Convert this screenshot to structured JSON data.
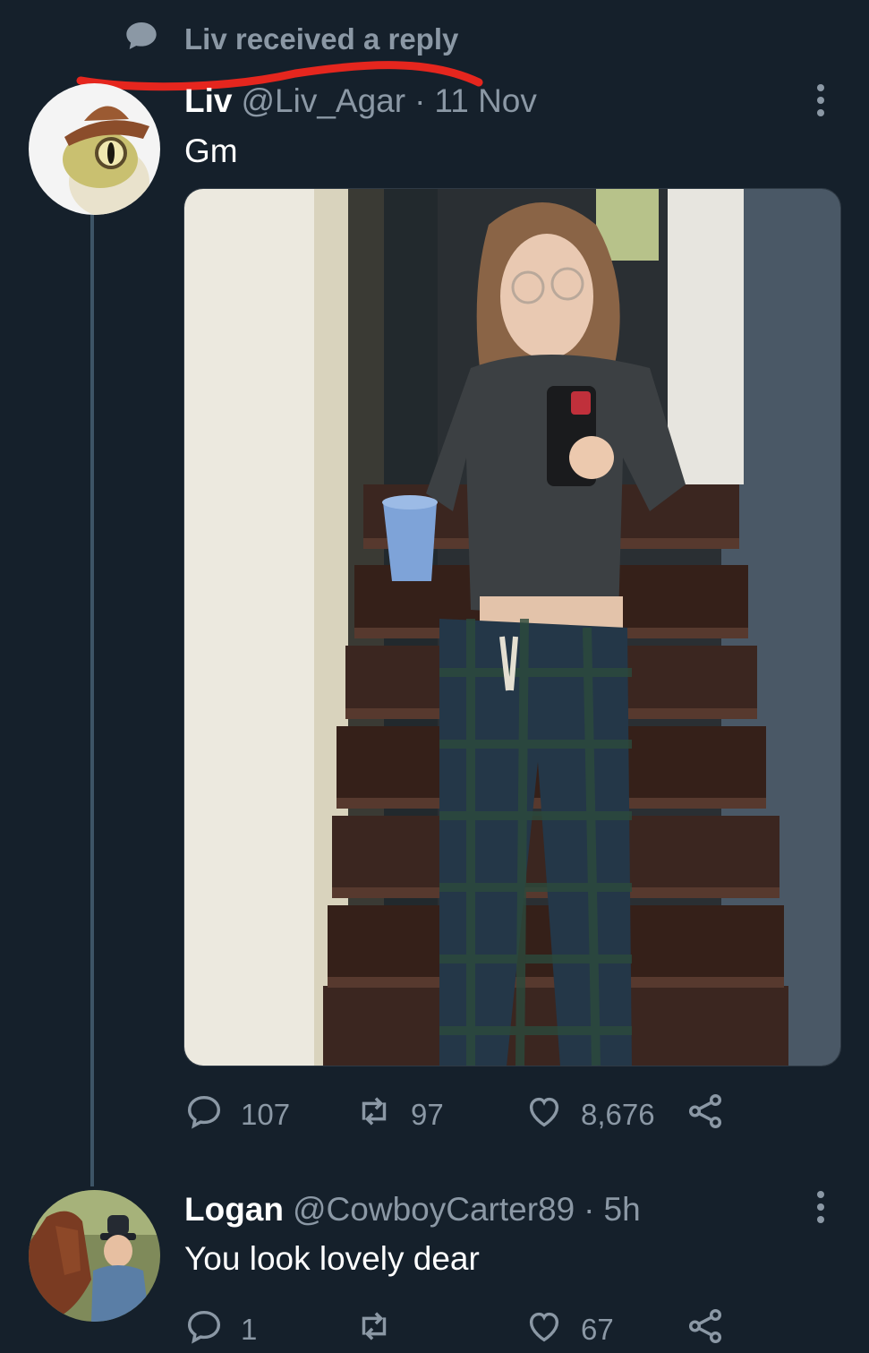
{
  "context": {
    "text": "Liv received a reply",
    "icon": "speech-bubble-icon"
  },
  "tweet": {
    "name": "Liv",
    "handle": "@Liv_Agar",
    "separator": "·",
    "time": "11 Nov",
    "text": "Gm",
    "media": "photo",
    "actions": {
      "replies": "107",
      "retweets": "97",
      "likes": "8,676"
    }
  },
  "reply": {
    "name": "Logan",
    "handle": "@CowboyCarter89",
    "separator": "·",
    "time": "5h",
    "text": "You look lovely dear",
    "actions": {
      "replies": "1",
      "retweets": "",
      "likes": "67"
    }
  },
  "colors": {
    "background": "#15202b",
    "secondary_text": "#8b98a5",
    "annotation_red": "#e5261e",
    "thread_line": "#3d5466"
  }
}
